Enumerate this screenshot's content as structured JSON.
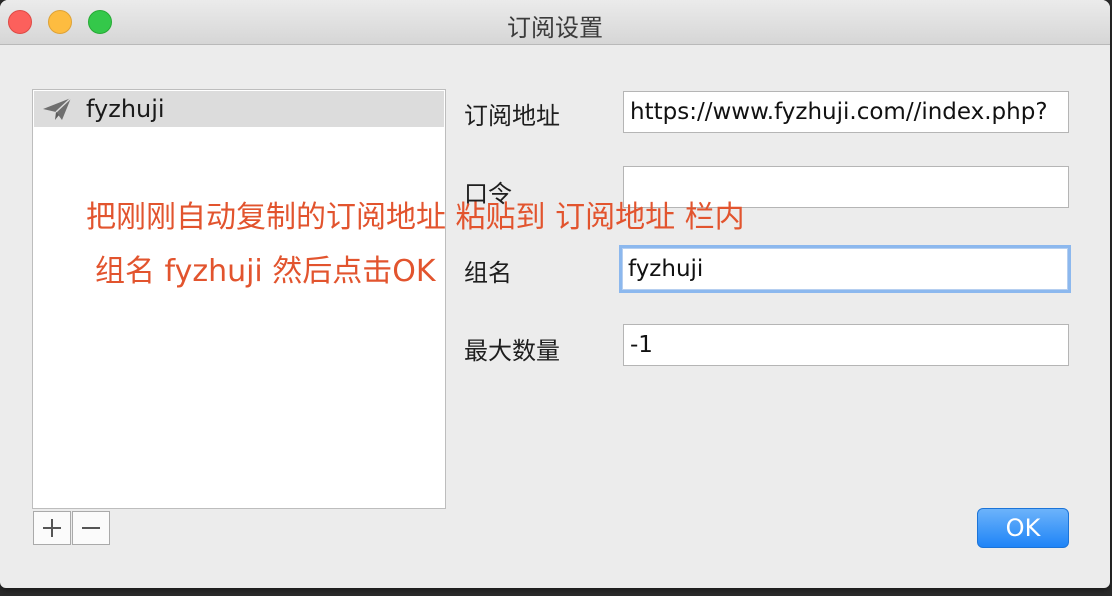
{
  "window": {
    "title": "订阅设置"
  },
  "sidebar": {
    "items": [
      {
        "label": "fyzhuji",
        "icon": "paper-plane-icon",
        "selected": true
      }
    ],
    "add_icon": "plus-icon",
    "remove_icon": "minus-icon"
  },
  "form": {
    "url_label": "订阅地址",
    "url_value": "https://www.fyzhuji.com//index.php?",
    "password_label": "口令",
    "password_value": "",
    "group_label": "组名",
    "group_value": "fyzhuji",
    "max_label": "最大数量",
    "max_value": "-1"
  },
  "annotation": {
    "line1": "把刚刚自动复制的订阅地址 粘贴到 订阅地址 栏内",
    "line2": "组名 fyzhuji 然后点击OK"
  },
  "buttons": {
    "ok_label": "OK"
  },
  "colors": {
    "accent": "#1f84f7",
    "annotation": "#e2542e",
    "focus_ring": "#8cb8ee"
  }
}
